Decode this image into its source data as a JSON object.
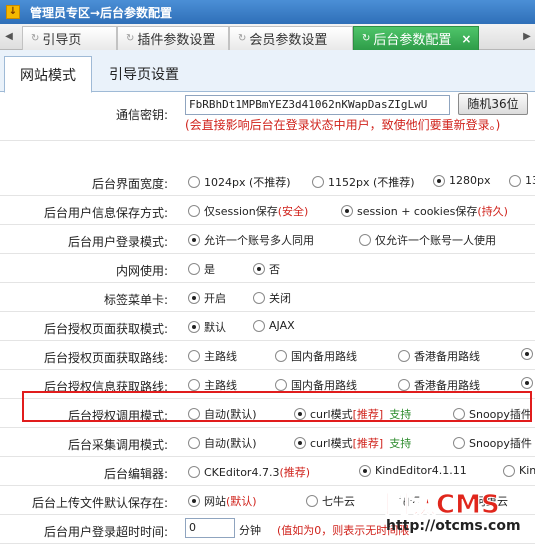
{
  "title": "管理员专区→后台参数配置",
  "tabs": [
    {
      "label": "引导页",
      "active": false
    },
    {
      "label": "插件参数设置",
      "active": false
    },
    {
      "label": "会员参数设置",
      "active": false
    },
    {
      "label": "后台参数配置",
      "active": true
    }
  ],
  "subtabs": [
    {
      "label": "网站模式",
      "active": true
    },
    {
      "label": "引导页设置",
      "active": false
    }
  ],
  "key": {
    "label": "通信密钥:",
    "value": "FbRBhDt1MPBmYEZ3d41062nKWapDasZIgLwU",
    "button": "随机36位",
    "note": "(会直接影响后台在登录状态中用户，致使他们要重新登录。)"
  },
  "width_row": {
    "label": "后台界面宽度:",
    "options": [
      {
        "text": "1024px (不推荐)",
        "on": false
      },
      {
        "text": "1152px (不推荐)",
        "on": false
      },
      {
        "text": "1280px",
        "on": true
      },
      {
        "text": "13",
        "on": false
      }
    ]
  },
  "save_row": {
    "label": "后台用户信息保存方式:",
    "opt1": {
      "text": "仅session保存",
      "extra": "(安全)",
      "on": false
    },
    "opt2": {
      "text": "session + cookies保存",
      "extra": "(持久)",
      "on": true
    }
  },
  "login_row": {
    "label": "后台用户登录模式:",
    "opt1": {
      "text": "允许一个账号多人同用",
      "on": true
    },
    "opt2": {
      "text": "仅允许一个账号一人使用",
      "on": false
    }
  },
  "intranet_row": {
    "label": "内网使用:",
    "opt1": {
      "text": "是",
      "on": false
    },
    "opt2": {
      "text": "否",
      "on": true
    }
  },
  "tabcard_row": {
    "label": "标签菜单卡:",
    "opt1": {
      "text": "开启",
      "on": true
    },
    "opt2": {
      "text": "关闭",
      "on": false
    }
  },
  "authmode_row": {
    "label": "后台授权页面获取模式:",
    "opt1": {
      "text": "默认",
      "on": true
    },
    "opt2": {
      "text": "AJAX",
      "on": false
    }
  },
  "authpath_row": {
    "label": "后台授权页面获取路线:",
    "options": [
      {
        "text": "主路线",
        "on": false
      },
      {
        "text": "国内备用路线",
        "on": false
      },
      {
        "text": "香港备用路线",
        "on": false
      },
      {
        "text": "",
        "on": true
      }
    ]
  },
  "infopath_row": {
    "label": "后台授权信息获取路线:",
    "options": [
      {
        "text": "主路线",
        "on": false
      },
      {
        "text": "国内备用路线",
        "on": false
      },
      {
        "text": "香港备用路线",
        "on": false
      },
      {
        "text": "",
        "on": true
      }
    ]
  },
  "authcall_row": {
    "label": "后台授权调用模式:",
    "opt1": {
      "text": "自动(默认)",
      "on": false
    },
    "opt2": {
      "text": "curl模式",
      "rec": "[推荐]",
      "support": "支持",
      "on": true
    },
    "opt3": {
      "text": "Snoopy插件",
      "on": false
    }
  },
  "collect_row": {
    "label": "后台采集调用模式:",
    "opt1": {
      "text": "自动(默认)",
      "on": false
    },
    "opt2": {
      "text": "curl模式",
      "rec": "[推荐]",
      "support": "支持",
      "on": true
    },
    "opt3": {
      "text": "Snoopy插件",
      "on": false
    }
  },
  "editor_row": {
    "label": "后台编辑器:",
    "opt1": {
      "text": "CKEditor4.7.3",
      "rec": "(推荐)",
      "on": false
    },
    "opt2": {
      "text": "KindEditor4.1.11",
      "on": true
    },
    "opt3": {
      "text": "Kin",
      "on": false
    }
  },
  "upload_row": {
    "label": "后台上传文件默认保存在:",
    "opt1": {
      "text": "网站",
      "extra": "(默认)",
      "on": true
    },
    "opt2": {
      "text": "七牛云",
      "on": false
    },
    "opt3": {
      "text": "拍云",
      "on": false
    },
    "opt4": {
      "text": "阿里云",
      "on": false
    }
  },
  "timeout_row": {
    "label": "后台用户登录超时时间:",
    "value": "0",
    "unit": "分钟",
    "note": "(值如为0，则表示无时间限"
  },
  "watermark": {
    "brand": "网钛CMS",
    "url": "http://otcms.com"
  },
  "colors": {
    "accent_green": "#2e9c48",
    "title_blue": "#2f6fb8",
    "red": "#d0231c"
  }
}
